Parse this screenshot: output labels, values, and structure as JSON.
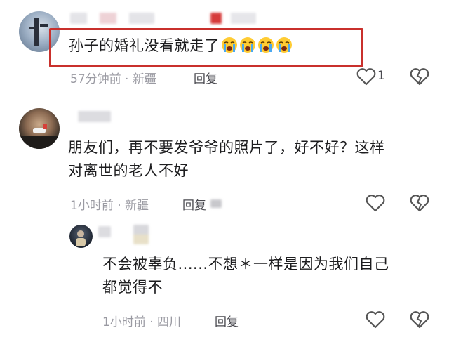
{
  "comments": [
    {
      "text": "孙子的婚礼没看就走了",
      "emoji_count_label": "loudly-crying-face",
      "time": "57分钟前",
      "location": "新疆",
      "reply_label": "回复",
      "like_count": "1"
    },
    {
      "text_line1": "朋友们，再不要发爷爷的照片了，好不好？这样",
      "text_line2": "对离世的老人不好",
      "time": "1小时前",
      "location": "新疆",
      "reply_label": "回复"
    },
    {
      "text_line1": "不会被辜负......不想＊一样是因为我们自己",
      "text_line2": "都觉得不",
      "time": "1小时前",
      "location": "四川",
      "reply_label": "回复"
    }
  ],
  "separator": " · ",
  "colors": {
    "highlight": "#c9302c",
    "meta": "#9a9aa2",
    "text": "#1d1d1f"
  }
}
